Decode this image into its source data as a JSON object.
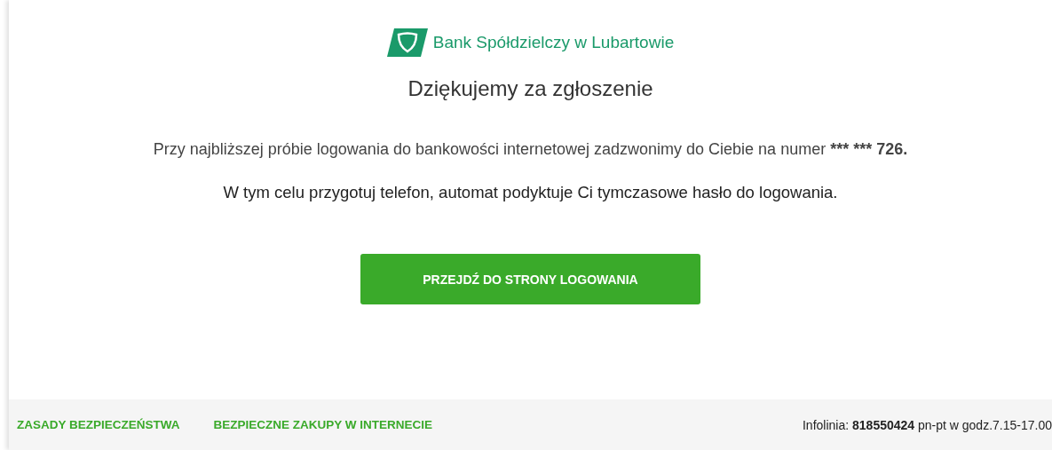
{
  "header": {
    "bank_name": "Bank Spółdzielczy w Lubartowie"
  },
  "title": "Dziękujemy za zgłoszenie",
  "phone_notice": {
    "text": "Przy najbliższej próbie logowania do bankowości internetowej zadzwonimy do Ciebie na numer",
    "number": "*** *** 726."
  },
  "messages": [
    "W tym celu przygotuj telefon, automat podyktuje Ci tymczasowe hasło do logowania."
  ],
  "button": "PRZEJDŹ DO STRONY LOGOWANIA",
  "footer": {
    "links": [
      "ZASADY BEZPIECZEŃSTWA",
      "BEZPIECZNE ZAKUPY W INTERNECIE"
    ],
    "hotline": "Infolinia: **818550424** pn-pt w godz.7.15-17.00"
  }
}
